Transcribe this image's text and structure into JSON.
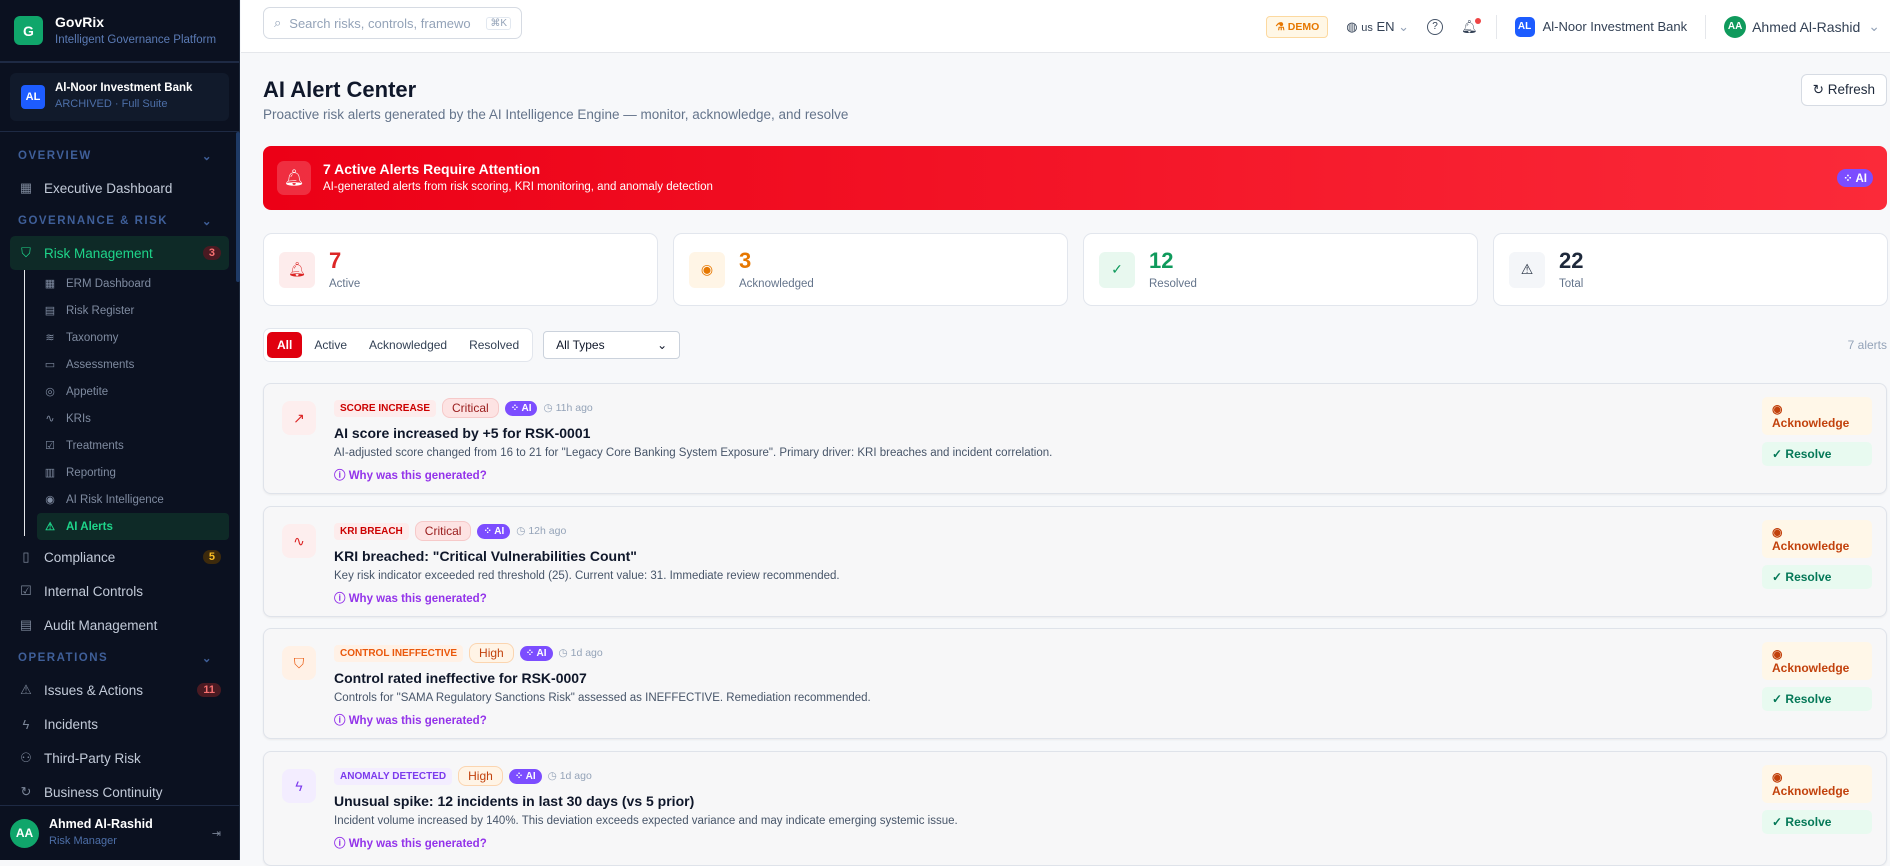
{
  "sidebar": {
    "brand": "GovRix",
    "tagline": "Intelligent Governance Platform",
    "org": {
      "initials": "AL",
      "name": "Al-Noor Investment Bank",
      "status": "ARCHIVED · Full Suite"
    },
    "sections": {
      "overview": "OVERVIEW",
      "governance": "GOVERNANCE & RISK",
      "operations": "OPERATIONS"
    },
    "items": {
      "exec": "Executive Dashboard",
      "risk": "Risk Management",
      "risk_badge": "3",
      "compliance": "Compliance",
      "compliance_badge": "5",
      "controls": "Internal Controls",
      "audit": "Audit Management",
      "issues": "Issues & Actions",
      "issues_badge": "11",
      "incidents": "Incidents",
      "tpr": "Third-Party Risk",
      "bc": "Business Continuity"
    },
    "sub": [
      "ERM Dashboard",
      "Risk Register",
      "Taxonomy",
      "Assessments",
      "Appetite",
      "KRIs",
      "Treatments",
      "Reporting",
      "AI Risk Intelligence",
      "AI Alerts"
    ],
    "user": {
      "initials": "AA",
      "name": "Ahmed Al-Rashid",
      "role": "Risk Manager"
    }
  },
  "topbar": {
    "search_placeholder": "Search risks, controls, framewo",
    "shortcut": "⌘K",
    "demo": "DEMO",
    "lang_flag": "us",
    "lang": "EN",
    "org_initials": "AL",
    "org": "Al-Noor Investment Bank",
    "user_initials": "AA",
    "user": "Ahmed Al-Rashid"
  },
  "page": {
    "title": "AI Alert Center",
    "subtitle": "Proactive risk alerts generated by the AI Intelligence Engine — monitor, acknowledge, and resolve",
    "refresh": "Refresh"
  },
  "banner": {
    "title": "7 Active Alerts Require Attention",
    "text": "AI-generated alerts from risk scoring, KRI monitoring, and anomaly detection",
    "ai": "AI"
  },
  "stats": [
    {
      "value": "7",
      "label": "Active",
      "color": "#dc2626"
    },
    {
      "value": "3",
      "label": "Acknowledged",
      "color": "#e67700"
    },
    {
      "value": "12",
      "label": "Resolved",
      "color": "#0f9a5c"
    },
    {
      "value": "22",
      "label": "Total",
      "color": "#1e293b"
    }
  ],
  "filters": {
    "tabs": [
      "All",
      "Active",
      "Acknowledged",
      "Resolved"
    ],
    "type": "All Types",
    "count": "7 alerts"
  },
  "alerts": [
    {
      "type": "SCORE INCREASE",
      "severity": "Critical",
      "ai": "AI",
      "ago": "11h ago",
      "title": "AI score increased by +5 for RSK-0001",
      "desc": "AI-adjusted score changed from 16 to 21 for \"Legacy Core Banking System Exposure\". Primary driver: KRI breaches and incident correlation.",
      "why": "Why was this generated?",
      "ack": "Acknowledge",
      "resolve": "Resolve"
    },
    {
      "type": "KRI BREACH",
      "severity": "Critical",
      "ai": "AI",
      "ago": "12h ago",
      "title": "KRI breached: \"Critical Vulnerabilities Count\"",
      "desc": "Key risk indicator exceeded red threshold (25). Current value: 31. Immediate review recommended.",
      "why": "Why was this generated?",
      "ack": "Acknowledge",
      "resolve": "Resolve"
    },
    {
      "type": "CONTROL INEFFECTIVE",
      "severity": "High",
      "ai": "AI",
      "ago": "1d ago",
      "title": "Control rated ineffective for RSK-0007",
      "desc": "Controls for \"SAMA Regulatory Sanctions Risk\" assessed as INEFFECTIVE. Remediation recommended.",
      "why": "Why was this generated?",
      "ack": "Acknowledge",
      "resolve": "Resolve"
    },
    {
      "type": "ANOMALY DETECTED",
      "severity": "High",
      "ai": "AI",
      "ago": "1d ago",
      "title": "Unusual spike: 12 incidents in last 30 days (vs 5 prior)",
      "desc": "Incident volume increased by 140%. This deviation exceeds expected variance and may indicate emerging systemic issue.",
      "why": "Why was this generated?",
      "ack": "Acknowledge",
      "resolve": "Resolve"
    }
  ]
}
